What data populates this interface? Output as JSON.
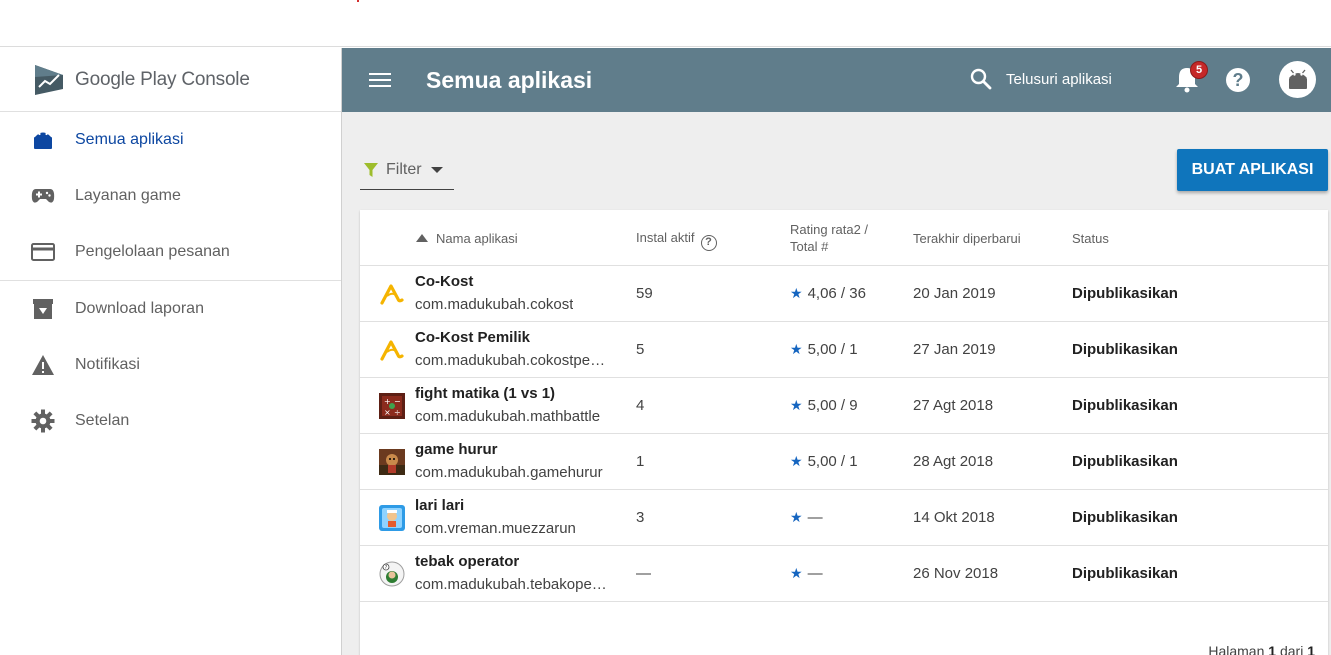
{
  "brand": {
    "name": "Google Play Console"
  },
  "sidebar": {
    "items": [
      {
        "label": "Semua aplikasi",
        "icon": "android-icon",
        "active": true
      },
      {
        "label": "Layanan game",
        "icon": "gamepad-icon"
      },
      {
        "label": "Pengelolaan pesanan",
        "icon": "credit-card-icon"
      },
      {
        "label": "Download laporan",
        "icon": "download-box-icon"
      },
      {
        "label": "Notifikasi",
        "icon": "warning-icon"
      },
      {
        "label": "Setelan",
        "icon": "gear-icon"
      }
    ]
  },
  "header": {
    "title": "Semua aplikasi",
    "search_label": "Telusuri aplikasi",
    "notification_count": "5",
    "help_glyph": "?"
  },
  "toolbar": {
    "filter_label": "Filter",
    "create_label": "BUAT APLIKASI"
  },
  "table": {
    "columns": {
      "name": "Nama aplikasi",
      "installs": "Instal aktif",
      "rating_line1": "Rating rata2 /",
      "rating_line2": "Total #",
      "updated": "Terakhir diperbarui",
      "status": "Status"
    },
    "rows": [
      {
        "name": "Co-Kost",
        "package": "com.madukubah.cokost",
        "installs": "59",
        "rating": "4,06 / 36",
        "updated": "20 Jan 2019",
        "status": "Dipublikasikan"
      },
      {
        "name": "Co-Kost Pemilik",
        "package": "com.madukubah.cokostpe…",
        "installs": "5",
        "rating": "5,00 / 1",
        "updated": "27 Jan 2019",
        "status": "Dipublikasikan"
      },
      {
        "name": "fight matika (1 vs 1)",
        "package": "com.madukubah.mathbattle",
        "installs": "4",
        "rating": "5,00 / 9",
        "updated": "27 Agt 2018",
        "status": "Dipublikasikan"
      },
      {
        "name": "game hurur",
        "package": "com.madukubah.gamehurur",
        "installs": "1",
        "rating": "5,00 / 1",
        "updated": "28 Agt 2018",
        "status": "Dipublikasikan"
      },
      {
        "name": "lari lari",
        "package": "com.vreman.muezzarun",
        "installs": "3",
        "rating": "—",
        "updated": "14 Okt 2018",
        "status": "Dipublikasikan"
      },
      {
        "name": "tebak operator",
        "package": "com.madukubah.tebakoper…",
        "installs": "—",
        "rating": "—",
        "updated": "26 Nov 2018",
        "status": "Dipublikasikan"
      }
    ]
  },
  "pager": {
    "prefix": "Halaman",
    "current": "1",
    "middle": "dari",
    "total": "1"
  },
  "colors": {
    "appbar": "#607d8b",
    "accent": "#0f75bc",
    "active_nav": "#0d47a1",
    "star": "#1565c0"
  }
}
